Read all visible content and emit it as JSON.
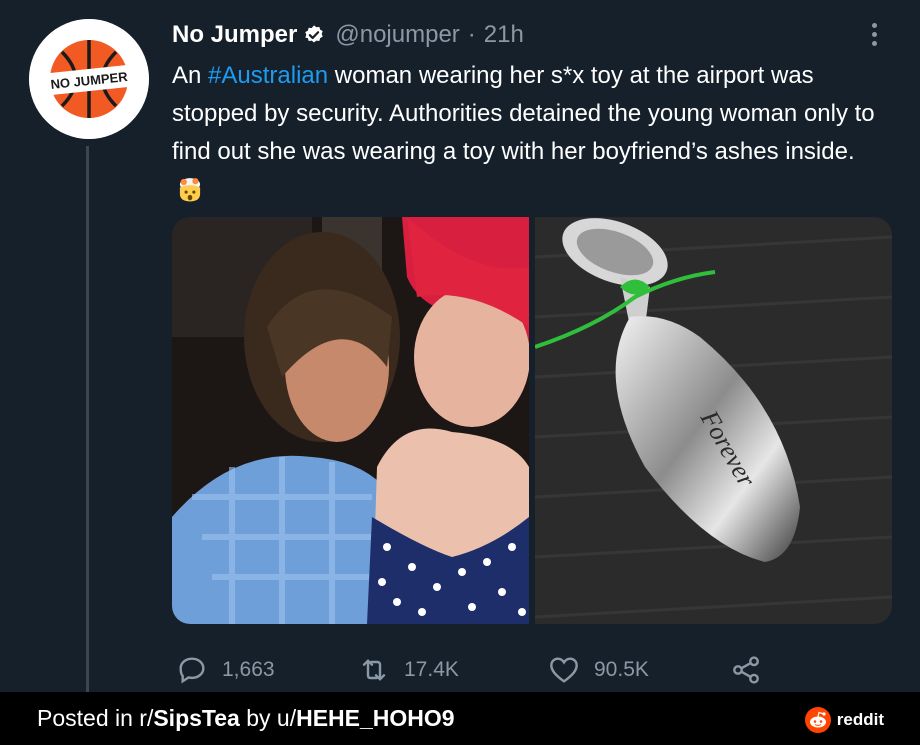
{
  "tweet": {
    "display_name": "No Jumper",
    "handle": "@nojumper",
    "separator": "·",
    "time": "21h",
    "avatar_text": "NO JUMPER",
    "text_before": "An ",
    "hashtag": "#Australian",
    "text_after": " woman wearing her s*x toy at the airport was stopped by security. Authorities detained the young woman only to find out she was wearing a toy with her boyfriend’s ashes inside.",
    "emoji_icon": "exploding-head-emoji",
    "engraving": "Forever"
  },
  "actions": {
    "replies": "1,663",
    "retweets": "17.4K",
    "likes": "90.5K"
  },
  "footer": {
    "prefix": "Posted in r/",
    "subreddit": "SipsTea",
    "middle": " by u/",
    "user": "HEHE_HOHO9",
    "brand": "reddit"
  },
  "colors": {
    "background": "#15202b",
    "hashtag": "#1d9bf0",
    "muted": "#8b98a5",
    "footer": "#000000",
    "reddit": "#ff4500"
  }
}
